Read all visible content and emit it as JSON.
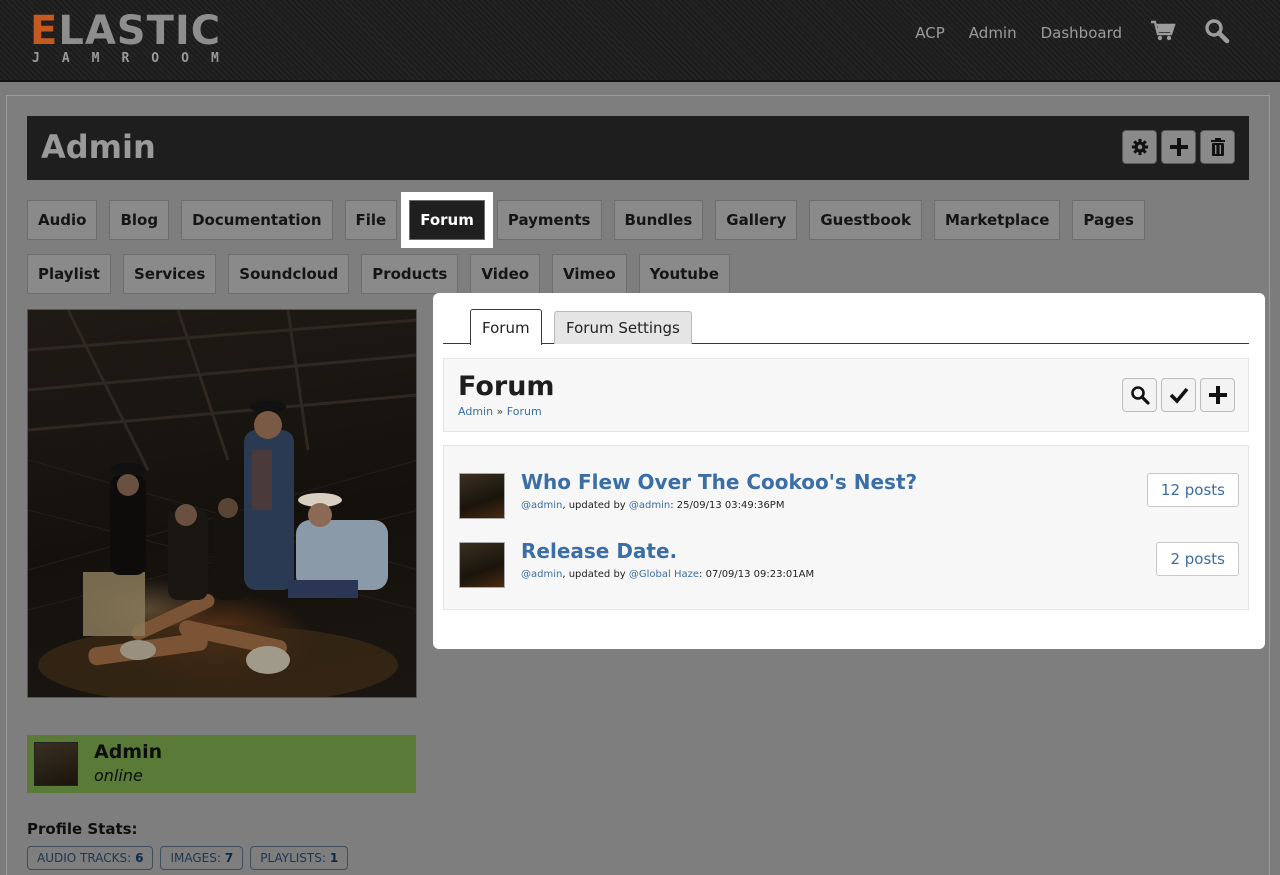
{
  "brand": {
    "word_first": "E",
    "word_rest": "LASTIC",
    "subtitle": "JAMROOM",
    "accent_color": "#c45a22"
  },
  "topnav": {
    "links": [
      "ACP",
      "Admin",
      "Dashboard"
    ],
    "cart_icon": "cart-icon",
    "search_icon": "search-icon"
  },
  "profile": {
    "title": "Admin",
    "header_buttons": [
      "gear-icon",
      "plus-icon",
      "trash-icon"
    ]
  },
  "modules": {
    "row1": [
      "Audio",
      "Blog",
      "Documentation",
      "File",
      "Forum",
      "Payments",
      "Bundles",
      "Gallery",
      "Guestbook",
      "Marketplace",
      "Pages"
    ],
    "row2": [
      "Playlist",
      "Services",
      "Soundcloud",
      "Products",
      "Video",
      "Vimeo",
      "Youtube"
    ],
    "active": "Forum"
  },
  "sidebar": {
    "name": "Admin",
    "status": "online",
    "stats_label": "Profile Stats:",
    "stats": [
      {
        "label": "AUDIO TRACKS:",
        "value": "6"
      },
      {
        "label": "IMAGES:",
        "value": "7"
      },
      {
        "label": "PLAYLISTS:",
        "value": "1"
      }
    ]
  },
  "forum": {
    "tabs": [
      "Forum",
      "Forum Settings"
    ],
    "active_tab": "Forum",
    "title": "Forum",
    "breadcrumb": {
      "root": "Admin",
      "sep": " » ",
      "current": "Forum"
    },
    "action_buttons": [
      "search-icon",
      "check-icon",
      "plus-icon"
    ],
    "topics": [
      {
        "title": "Who Flew Over The Cookoo's Nest?",
        "author": "@admin",
        "updated_by_text": ", updated by ",
        "updated_by": "@admin",
        "date": ": 25/09/13 03:49:36PM",
        "posts": "12 posts"
      },
      {
        "title": "Release Date.",
        "author": "@admin",
        "updated_by_text": ", updated by ",
        "updated_by": "@Global Haze",
        "date": ": 07/09/13 09:23:01AM",
        "posts": "2 posts"
      }
    ]
  }
}
